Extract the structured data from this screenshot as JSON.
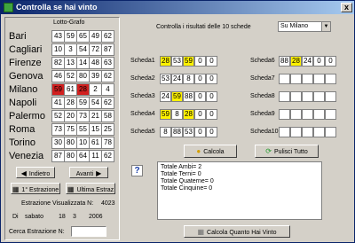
{
  "window": {
    "title": "Controlla se hai vinto",
    "close": "x"
  },
  "left": {
    "title": "Lotto-Grafo",
    "wheels": [
      {
        "name": "Bari",
        "nums": [
          "43",
          "59",
          "65",
          "49",
          "62"
        ],
        "red": []
      },
      {
        "name": "Cagliari",
        "nums": [
          "10",
          "3",
          "54",
          "72",
          "87"
        ],
        "red": []
      },
      {
        "name": "Firenze",
        "nums": [
          "82",
          "13",
          "14",
          "48",
          "63"
        ],
        "red": []
      },
      {
        "name": "Genova",
        "nums": [
          "46",
          "52",
          "80",
          "39",
          "62"
        ],
        "red": []
      },
      {
        "name": "Milano",
        "nums": [
          "59",
          "61",
          "28",
          "2",
          "4"
        ],
        "red": [
          0,
          2
        ]
      },
      {
        "name": "Napoli",
        "nums": [
          "41",
          "28",
          "59",
          "54",
          "62"
        ],
        "red": []
      },
      {
        "name": "Palermo",
        "nums": [
          "52",
          "20",
          "73",
          "21",
          "58"
        ],
        "red": []
      },
      {
        "name": "Roma",
        "nums": [
          "73",
          "75",
          "55",
          "15",
          "25"
        ],
        "red": []
      },
      {
        "name": "Torino",
        "nums": [
          "30",
          "80",
          "10",
          "61",
          "78"
        ],
        "red": []
      },
      {
        "name": "Venezia",
        "nums": [
          "87",
          "80",
          "64",
          "11",
          "62"
        ],
        "red": []
      }
    ],
    "back_label": "Indietro",
    "forward_label": "Avanti",
    "first_label": "1° Estrazione",
    "last_label": "Ultima Estraz",
    "estrazione_label": "Estrazione Visualizzata N:",
    "estrazione_value": "4023",
    "date_label": "Di",
    "day_name": "sabato",
    "day": "18",
    "month": "3",
    "year": "2006",
    "search_label": "Cerca Estrazione N:",
    "search_value": ""
  },
  "right": {
    "control_label": "Controlla i risultati delle 10 schede",
    "wheel_select": "Su Milano",
    "schede_left": [
      {
        "label": "Scheda1",
        "vals": [
          "28",
          "53",
          "59",
          "0",
          "0"
        ],
        "yellow": [
          0,
          2
        ]
      },
      {
        "label": "Scheda2",
        "vals": [
          "53",
          "24",
          "8",
          "0",
          "0"
        ],
        "yellow": []
      },
      {
        "label": "Scheda3",
        "vals": [
          "24",
          "59",
          "88",
          "0",
          "0"
        ],
        "yellow": [
          1
        ]
      },
      {
        "label": "Scheda4",
        "vals": [
          "59",
          "8",
          "28",
          "0",
          "0"
        ],
        "yellow": [
          0,
          2
        ]
      },
      {
        "label": "Scheda5",
        "vals": [
          "8",
          "88",
          "53",
          "0",
          "0"
        ],
        "yellow": []
      }
    ],
    "schede_right": [
      {
        "label": "Scheda6",
        "vals": [
          "88",
          "28",
          "24",
          "0",
          "0"
        ],
        "yellow": [
          1
        ]
      },
      {
        "label": "Scheda7",
        "vals": [
          "",
          "",
          "",
          "",
          ""
        ],
        "yellow": []
      },
      {
        "label": "Scheda8",
        "vals": [
          "",
          "",
          "",
          "",
          ""
        ],
        "yellow": []
      },
      {
        "label": "Scheda9",
        "vals": [
          "",
          "",
          "",
          "",
          ""
        ],
        "yellow": []
      },
      {
        "label": "Scheda10",
        "vals": [
          "",
          "",
          "",
          "",
          ""
        ],
        "yellow": []
      }
    ],
    "calcola_label": "Calcola",
    "pulisci_label": "Pulisci Tutto",
    "help_label": "?",
    "results": [
      "Totale Ambi= 2",
      "Totale Terni= 0",
      "Totale Quaterne= 0",
      "Totale Cinquine= 0"
    ],
    "calcola_vinto_label": "Calcola Quanto Hai Vinto"
  }
}
